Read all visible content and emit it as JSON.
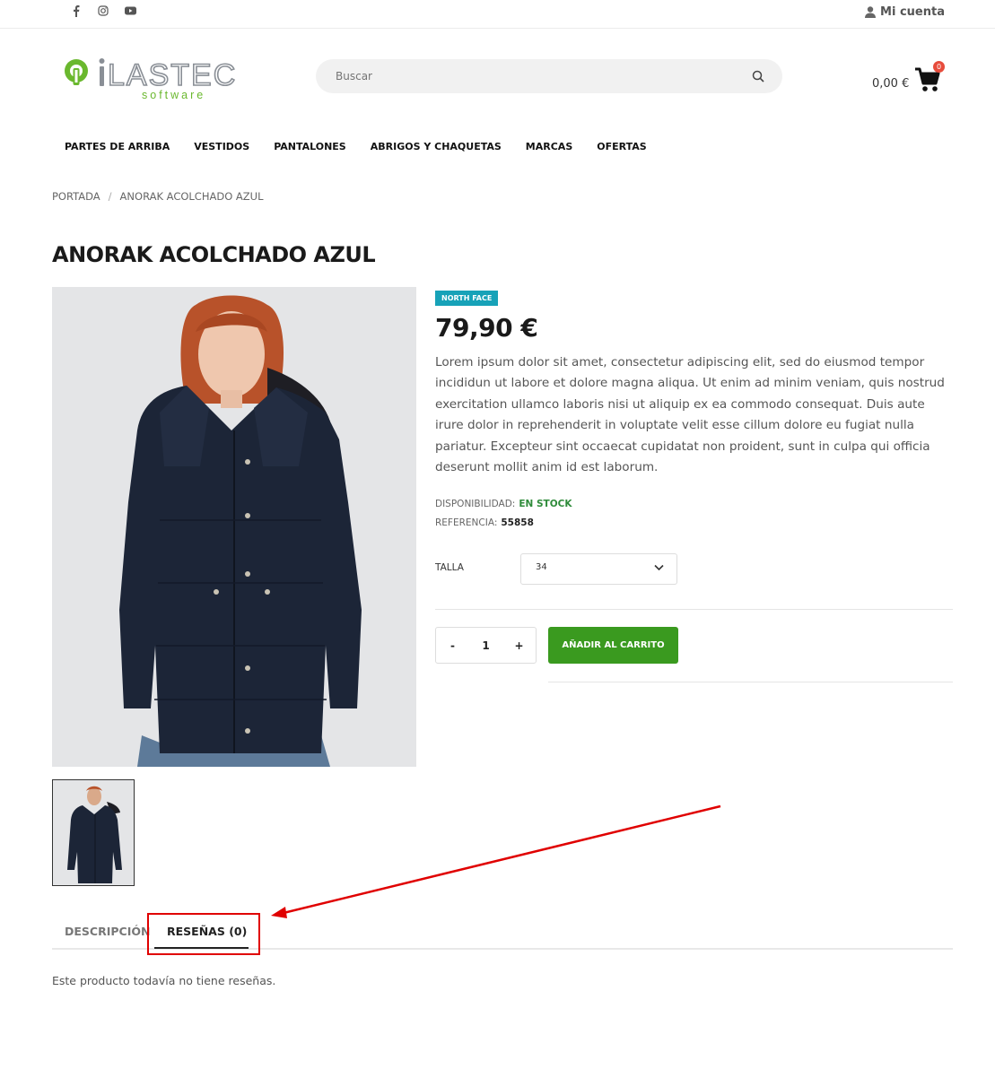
{
  "topbar": {
    "social_icons": [
      "facebook-icon",
      "instagram-icon",
      "youtube-icon"
    ],
    "account_label": "Mi cuenta"
  },
  "logo": {
    "name": "iLASTEC",
    "tagline": "software"
  },
  "search": {
    "placeholder": "Buscar"
  },
  "cart": {
    "total": "0,00 €",
    "count": "0"
  },
  "nav": {
    "items": [
      "PARTES DE ARRIBA",
      "VESTIDOS",
      "PANTALONES",
      "ABRIGOS Y CHAQUETAS",
      "MARCAS",
      "OFERTAS"
    ]
  },
  "breadcrumb": {
    "home": "PORTADA",
    "separator": "/",
    "current": "ANORAK ACOLCHADO AZUL"
  },
  "product": {
    "title": "ANORAK ACOLCHADO AZUL",
    "brand": "NORTH FACE",
    "price": "79,90 €",
    "description": "Lorem ipsum dolor sit amet, consectetur adipiscing elit, sed do eiusmod tempor incididun ut labore et dolore magna aliqua. Ut enim ad minim veniam, quis nostrud exercitation ullamco laboris nisi ut aliquip ex ea commodo consequat. Duis aute irure dolor in reprehenderit in voluptate velit esse cillum dolore eu fugiat nulla pariatur. Excepteur sint occaecat cupidatat non proident, sunt in culpa qui officia deserunt mollit anim id est laborum.",
    "availability_label": "DISPONIBILIDAD:",
    "availability_value": "EN STOCK",
    "reference_label": "REFERENCIA:",
    "reference_value": "55858",
    "size_label": "TALLA",
    "size_value": "34",
    "qty_minus": "-",
    "qty_value": "1",
    "qty_plus": "+",
    "add_to_cart": "AÑADIR AL CARRITO"
  },
  "tabs": {
    "description": "DESCRIPCIÓN",
    "reviews": "RESEÑAS (0)",
    "reviews_content": "Este producto todavía no tiene reseñas."
  },
  "colors": {
    "accent_green": "#3a9a1f",
    "brand_badge": "#17a2b8",
    "stock_green": "#2e8b3a",
    "annotation_red": "#e00000",
    "cart_badge": "#e74c3c"
  }
}
